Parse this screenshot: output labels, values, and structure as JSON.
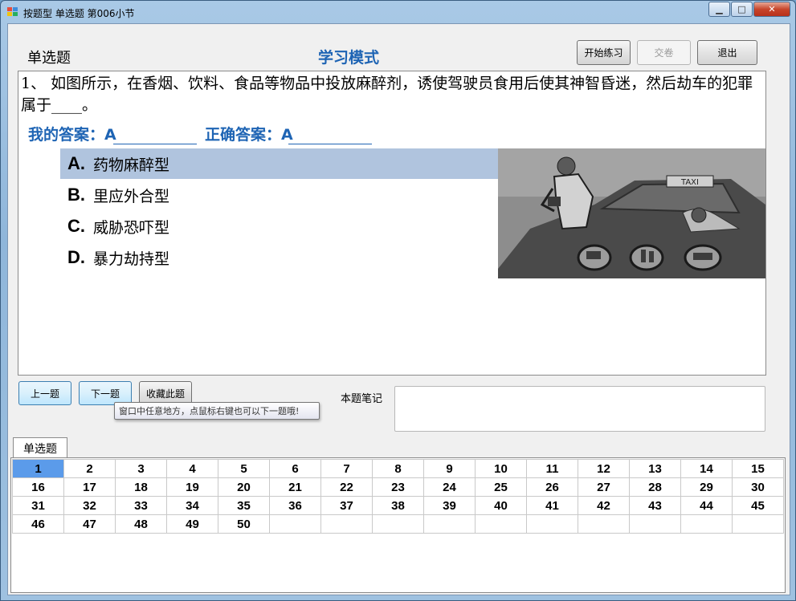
{
  "window": {
    "title": "按题型  单选题 第006小节",
    "controls": {
      "minimize": "▁",
      "maximize": "□",
      "close": "✕"
    }
  },
  "header": {
    "question_type": "单选题",
    "mode": "学习模式",
    "start_label": "开始练习",
    "submit_label": "交卷",
    "exit_label": "退出"
  },
  "question": {
    "text": "1、      如图所示，在香烟、饮料、食品等物品中投放麻醉剂，诱使驾驶员食用后使其神智昏迷，然后劫车的犯罪属于____。",
    "my_answer_label": "我的答案：A",
    "correct_answer_label": "正确答案：A",
    "options": [
      {
        "letter": "A.",
        "text": "药物麻醉型",
        "selected": true
      },
      {
        "letter": "B.",
        "text": "里应外合型",
        "selected": false
      },
      {
        "letter": "C.",
        "text": "威胁恐吓型",
        "selected": false
      },
      {
        "letter": "D.",
        "text": "暴力劫持型",
        "selected": false
      }
    ],
    "image_sign": "TAXI"
  },
  "nav": {
    "prev_label": "上一题",
    "next_label": "下一题",
    "bookmark_label": "收藏此题",
    "tooltip": "窗口中任意地方，点鼠标右键也可以下一题哦!"
  },
  "notes": {
    "label": "本题笔记",
    "value": ""
  },
  "tab": {
    "label": "单选题"
  },
  "question_grid": {
    "current": 1,
    "columns": 15,
    "numbers": [
      1,
      2,
      3,
      4,
      5,
      6,
      7,
      8,
      9,
      10,
      11,
      12,
      13,
      14,
      15,
      16,
      17,
      18,
      19,
      20,
      21,
      22,
      23,
      24,
      25,
      26,
      27,
      28,
      29,
      30,
      31,
      32,
      33,
      34,
      35,
      36,
      37,
      38,
      39,
      40,
      41,
      42,
      43,
      44,
      45,
      46,
      47,
      48,
      49,
      50
    ]
  },
  "colors": {
    "accent": "#1e64b4",
    "selected_option": "#b0c4de",
    "current_cell": "#5b9bea"
  }
}
